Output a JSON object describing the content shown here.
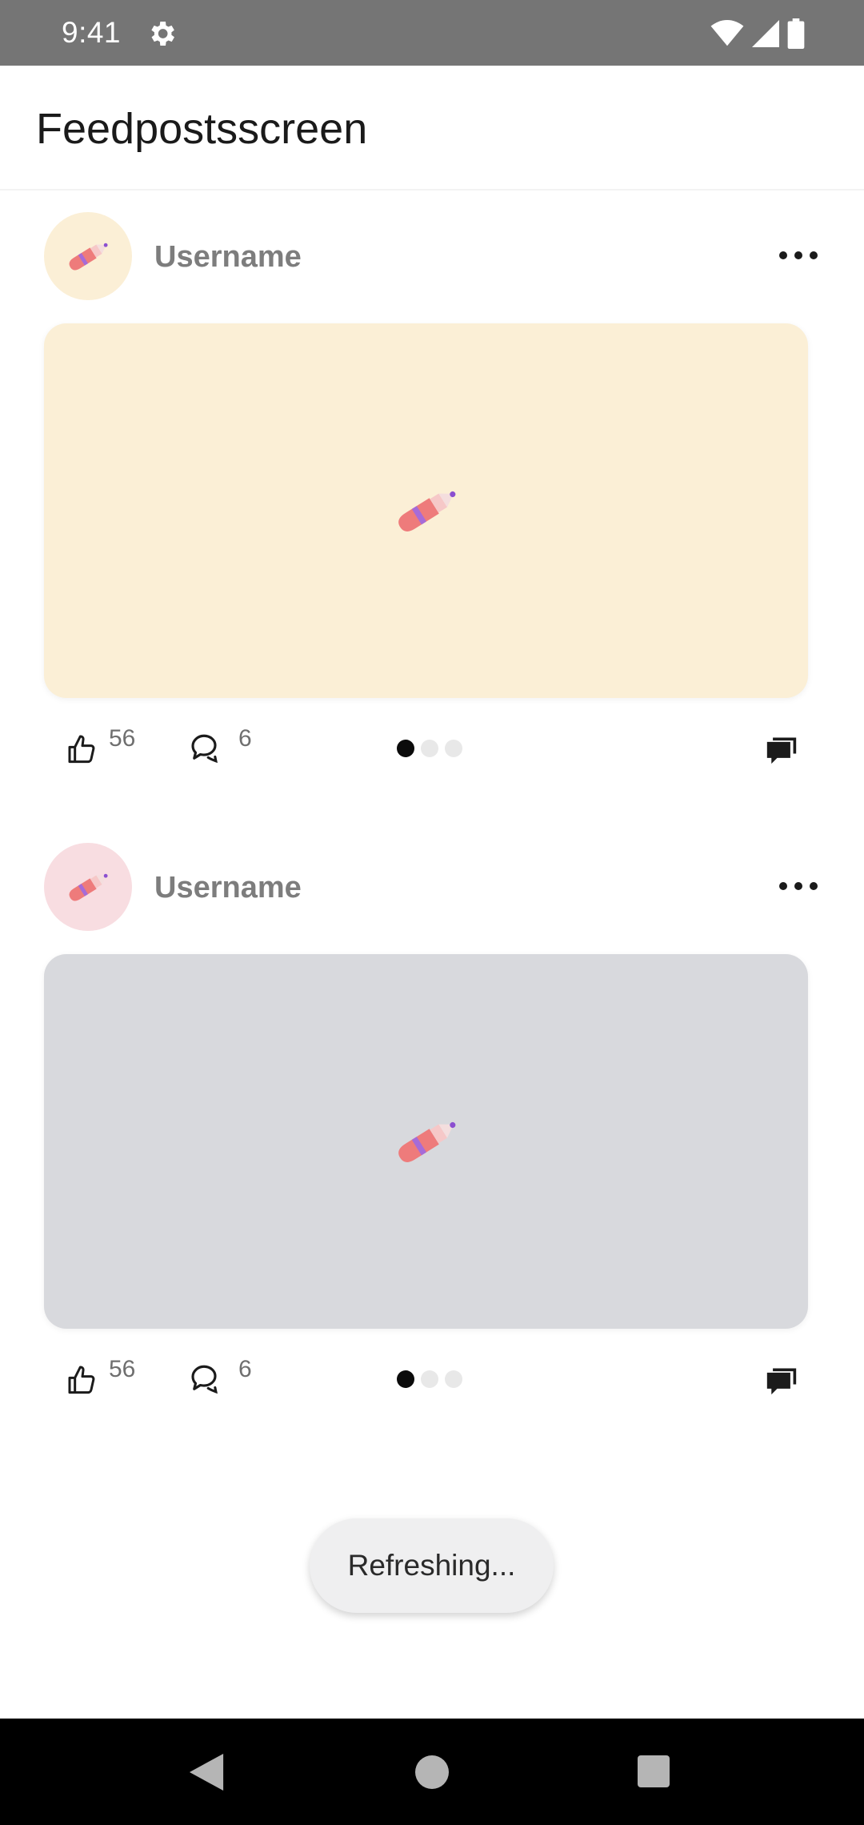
{
  "status_bar": {
    "time": "9:41",
    "icons": [
      "settings-icon",
      "wifi-icon",
      "signal-icon",
      "battery-icon"
    ]
  },
  "app_bar": {
    "title": "Feedpostsscreen"
  },
  "posts": [
    {
      "username": "Username",
      "avatar_icon": "pen-icon",
      "avatar_bg": "#fbefd6",
      "media_bg": "#fbefd6",
      "media_icon": "pen-icon",
      "likes": "56",
      "comments": "6",
      "carousel_pages": 3,
      "carousel_active": 1
    },
    {
      "username": "Username",
      "avatar_icon": "pen-icon",
      "avatar_bg": "#f8dde1",
      "media_bg": "#d8d9dd",
      "media_icon": "pen-icon",
      "likes": "56",
      "comments": "6",
      "carousel_pages": 3,
      "carousel_active": 1
    }
  ],
  "toast": {
    "text": "Refreshing..."
  },
  "nav_bar": {
    "buttons": [
      "back-icon",
      "home-icon",
      "recents-icon"
    ]
  }
}
